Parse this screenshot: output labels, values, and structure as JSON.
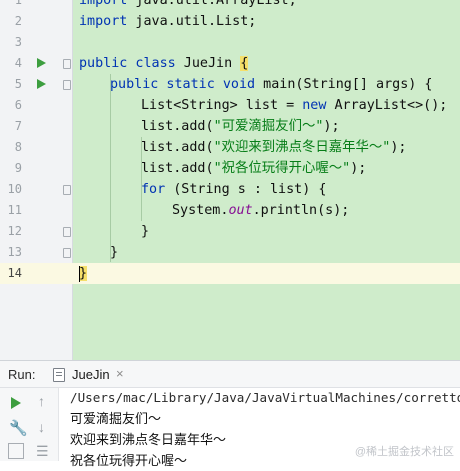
{
  "editor": {
    "lines": [
      {
        "num": "1",
        "parts": [
          {
            "t": "import",
            "c": "kw"
          },
          {
            "t": " java.util.ArrayList;",
            "c": ""
          }
        ]
      },
      {
        "num": "2",
        "parts": [
          {
            "t": "import",
            "c": "kw"
          },
          {
            "t": " java.util.List;",
            "c": ""
          }
        ]
      },
      {
        "num": "3",
        "parts": []
      },
      {
        "num": "4",
        "parts": [
          {
            "t": "public class",
            "c": "kw"
          },
          {
            "t": " JueJin ",
            "c": ""
          },
          {
            "t": "{",
            "c": "br-hl"
          }
        ]
      },
      {
        "num": "5",
        "parts": [
          {
            "t": "public static void",
            "c": "kw"
          },
          {
            "t": " main(String[] args) {",
            "c": ""
          }
        ]
      },
      {
        "num": "6",
        "parts": [
          {
            "t": "List<String> list = ",
            "c": ""
          },
          {
            "t": "new",
            "c": "kw"
          },
          {
            "t": " ArrayList<>();",
            "c": ""
          }
        ]
      },
      {
        "num": "7",
        "parts": [
          {
            "t": "list.add(",
            "c": ""
          },
          {
            "t": "\"可爱滴掘友们～\"",
            "c": "str"
          },
          {
            "t": ");",
            "c": ""
          }
        ]
      },
      {
        "num": "8",
        "parts": [
          {
            "t": "list.add(",
            "c": ""
          },
          {
            "t": "\"欢迎来到沸点冬日嘉年华～\"",
            "c": "str"
          },
          {
            "t": ");",
            "c": ""
          }
        ]
      },
      {
        "num": "9",
        "parts": [
          {
            "t": "list.add(",
            "c": ""
          },
          {
            "t": "\"祝各位玩得开心喔～\"",
            "c": "str"
          },
          {
            "t": ");",
            "c": ""
          }
        ]
      },
      {
        "num": "10",
        "parts": [
          {
            "t": "for",
            "c": "kw"
          },
          {
            "t": " (String s : list) {",
            "c": ""
          }
        ]
      },
      {
        "num": "11",
        "parts": [
          {
            "t": "System.",
            "c": ""
          },
          {
            "t": "out",
            "c": "fld"
          },
          {
            "t": ".println(s);",
            "c": ""
          }
        ]
      },
      {
        "num": "12",
        "parts": [
          {
            "t": "}",
            "c": ""
          }
        ]
      },
      {
        "num": "13",
        "parts": [
          {
            "t": "}",
            "c": ""
          }
        ]
      },
      {
        "num": "14",
        "parts": [
          {
            "t": "}",
            "c": "br-hl"
          }
        ]
      }
    ]
  },
  "run_panel": {
    "label": "Run:",
    "tab_label": "JueJin",
    "tab_close": "×",
    "console_lines": [
      "/Users/mac/Library/Java/JavaVirtualMachines/corretto",
      "可爱滴掘友们～",
      "欢迎来到沸点冬日嘉年华～",
      "祝各位玩得开心喔～"
    ],
    "watermark": "@稀土掘金技术社区"
  },
  "colors": {
    "editor_bg": "#cfeccb",
    "keyword": "#0033b3",
    "string": "#067d17",
    "run_green": "#3d9e3f"
  },
  "icons": [
    "run-gutter-icon",
    "file-icon",
    "close-icon",
    "rerun-icon",
    "wrench-icon",
    "up-arrow-icon",
    "down-arrow-icon",
    "list-icon"
  ]
}
